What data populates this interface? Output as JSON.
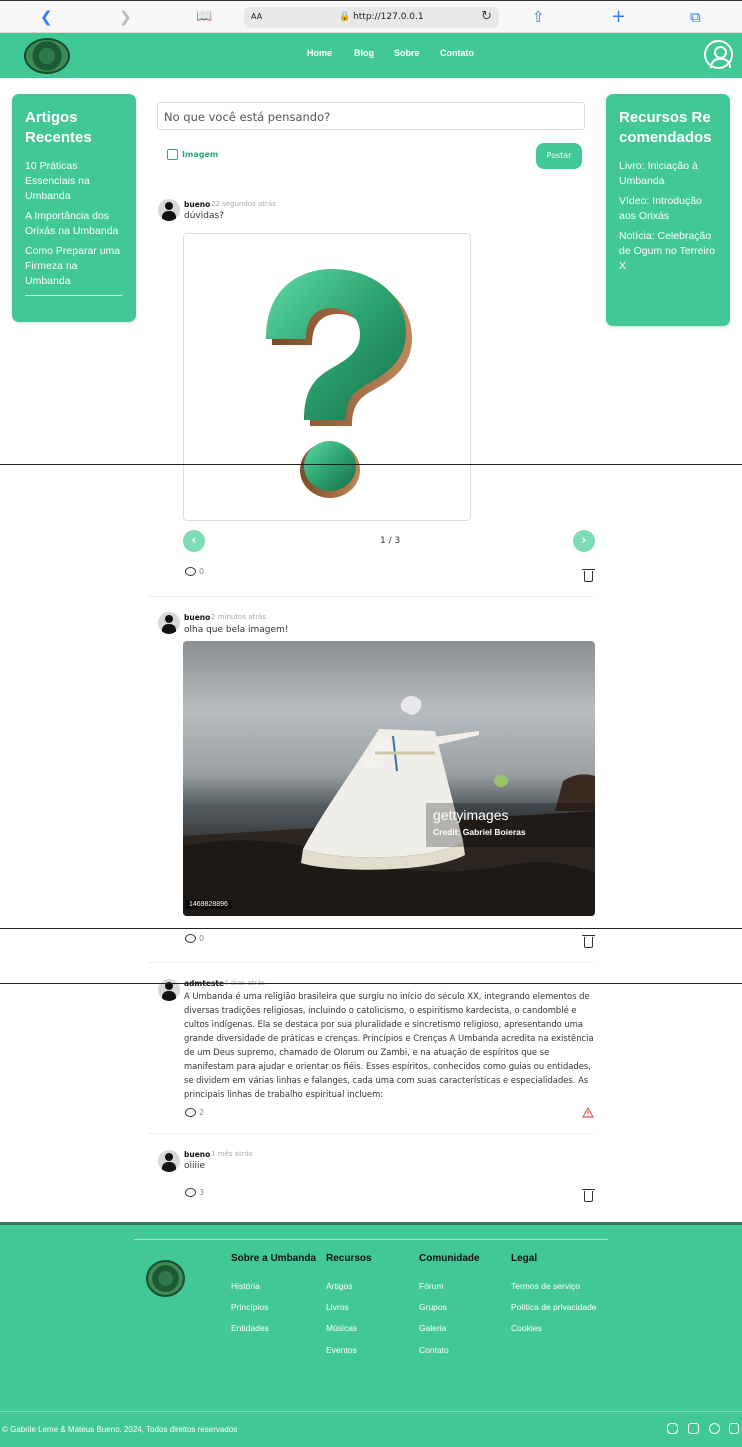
{
  "browser": {
    "text_size": "AA",
    "url": "http://127.0.0.1"
  },
  "nav": {
    "links": [
      "Home",
      "Blog",
      "Sobre",
      "Contato"
    ]
  },
  "left_card": {
    "title": "Artigos Recentes",
    "items": [
      "10 Práticas Essenciais na Umbanda",
      "A Importância dos Orixás na Umbanda",
      "Como Preparar uma Firmeza na Umbanda"
    ]
  },
  "right_card": {
    "title": "Recursos Recomendados",
    "items": [
      "Livro: Iniciação à Umbanda",
      "Vídeo: Introdução aos Orixás",
      "Notícia: Celebração de Ogum no Terreiro X"
    ]
  },
  "composer": {
    "placeholder": "No que você está pensando?",
    "image_label": "Imagem",
    "post_label": "Postar"
  },
  "posts": [
    {
      "user": "bueno",
      "time": "22 segundos atrás",
      "text": "dúvidas?",
      "pager": "1 / 3",
      "prev": "‹",
      "next": "›",
      "comments": "0"
    },
    {
      "user": "bueno",
      "time": "2 minutos atrás",
      "text": "olha que bela imagem!",
      "photo_watermark": "gettyimages",
      "photo_credit": "Credit: Gabriel Boieras",
      "photo_id": "1469828896",
      "comments": "0"
    },
    {
      "user": "admteste",
      "time": "4 dias atrás",
      "text": "A Umbanda é uma religião brasileira que surgiu no início do século XX, integrando elementos de diversas tradições religiosas, incluindo o catolicismo, o espiritismo kardecista, o candomblé e cultos indígenas. Ela se destaca por sua pluralidade e sincretismo religioso, apresentando uma grande diversidade de práticas e crenças. Princípios e Crenças A Umbanda acredita na existência de um Deus supremo, chamado de Olorum ou Zambi, e na atuação de espíritos que se manifestam para ajudar e orientar os fiéis. Esses espíritos, conhecidos como guias ou entidades, se dividem em várias linhas e falanges, cada uma com suas características e especialidades. As principais linhas de trabalho espiritual incluem:",
      "comments": "2"
    },
    {
      "user": "bueno",
      "time": "1 mês atrás",
      "text": "oiiiie",
      "comments": "3"
    }
  ],
  "footer": {
    "columns": [
      {
        "title": "Sobre a Umbanda",
        "links": [
          "História",
          "Princípios",
          "Entidades"
        ]
      },
      {
        "title": "Recursos",
        "links": [
          "Artigos",
          "Livros",
          "Músicas",
          "Eventos"
        ]
      },
      {
        "title": "Comunidade",
        "links": [
          "Fórum",
          "Grupos",
          "Galeria",
          "Contato"
        ]
      },
      {
        "title": "Legal",
        "links": [
          "Termos de serviço",
          "Política de privacidade",
          "Cookies"
        ]
      }
    ],
    "copyright": "© Gabrile Leme & Mateus Bueno. 2024, Todos direitos reservados"
  },
  "colors": {
    "brand": "#42c897",
    "brand_dark": "#2aa876"
  }
}
